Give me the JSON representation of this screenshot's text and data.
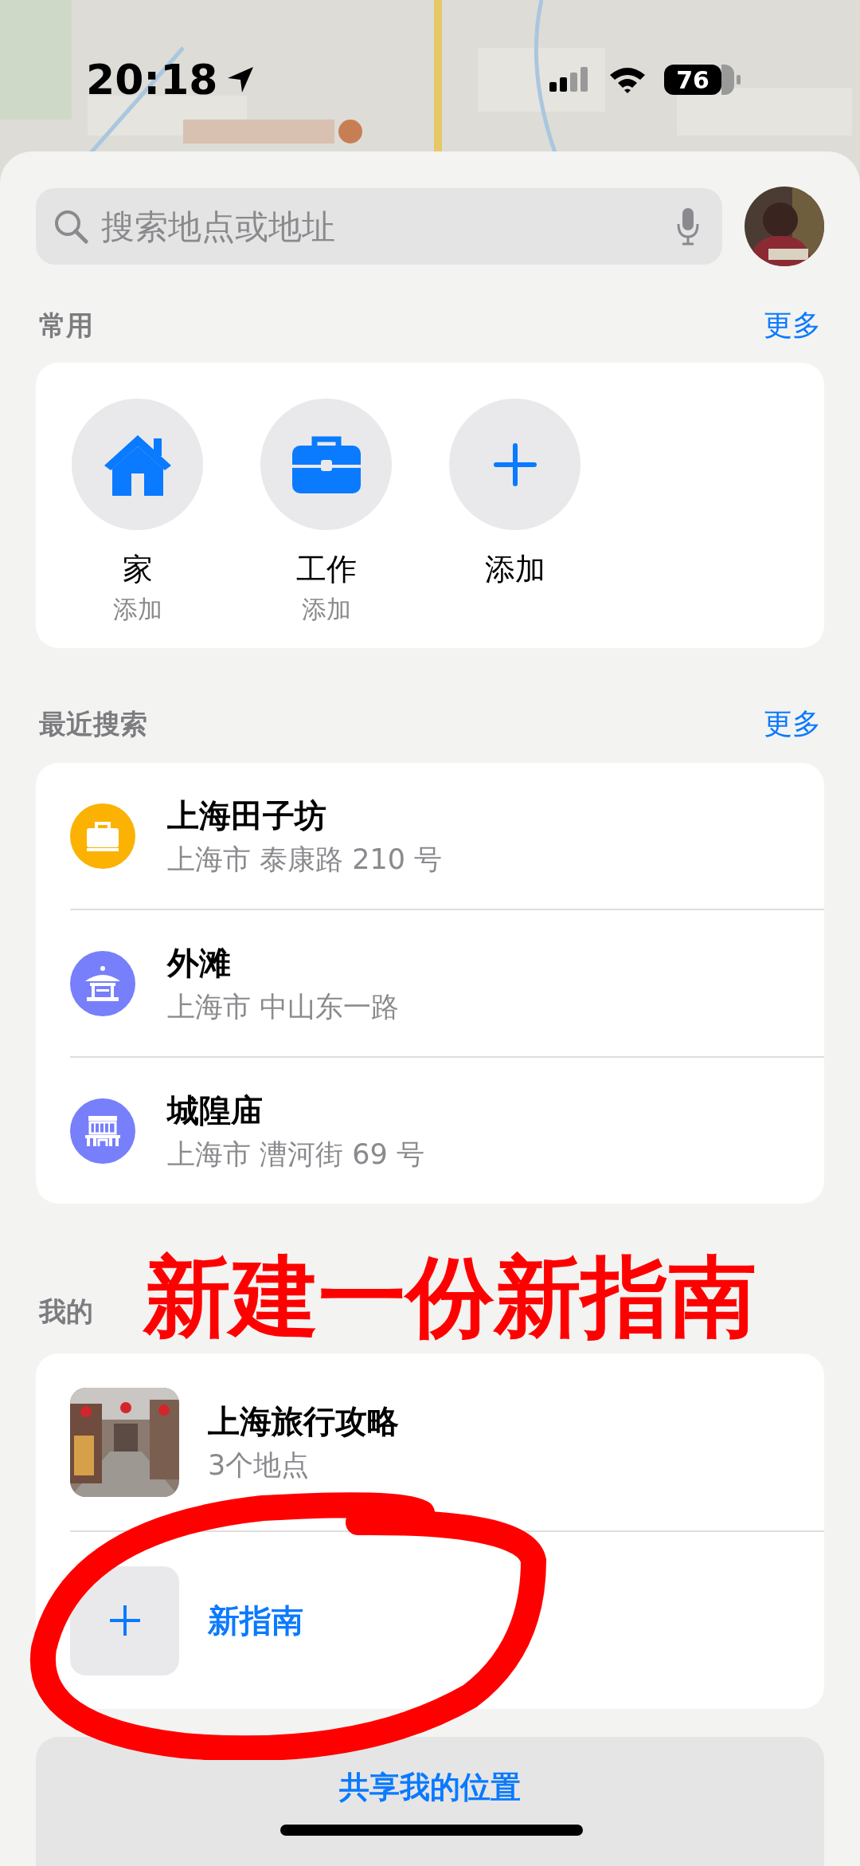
{
  "status_bar": {
    "time": "20:18",
    "battery": "76"
  },
  "search": {
    "placeholder": "搜索地点或地址"
  },
  "favorites": {
    "title": "常用",
    "more": "更多",
    "items": [
      {
        "kind": "home",
        "label": "家",
        "sublabel": "添加"
      },
      {
        "kind": "work",
        "label": "工作",
        "sublabel": "添加"
      },
      {
        "kind": "add",
        "label": "添加"
      }
    ]
  },
  "recents": {
    "title": "最近搜索",
    "more": "更多",
    "items": [
      {
        "kind": "shopping",
        "color": "#fbb203",
        "name": "上海田子坊",
        "address": "上海市 泰康路 210 号"
      },
      {
        "kind": "pavilion",
        "color": "#777ffb",
        "name": "外滩",
        "address": "上海市 中山东一路"
      },
      {
        "kind": "temple",
        "color": "#777ffb",
        "name": "城隍庙",
        "address": "上海市 漕河街 69 号"
      }
    ]
  },
  "guides": {
    "title": "我的",
    "items": [
      {
        "kind": "guide",
        "name": "上海旅行攻略",
        "detail": "3个地点"
      },
      {
        "kind": "new",
        "name": "新指南"
      }
    ]
  },
  "annotation": {
    "text": "新建一份新指南"
  },
  "share_button": "共享我的位置"
}
